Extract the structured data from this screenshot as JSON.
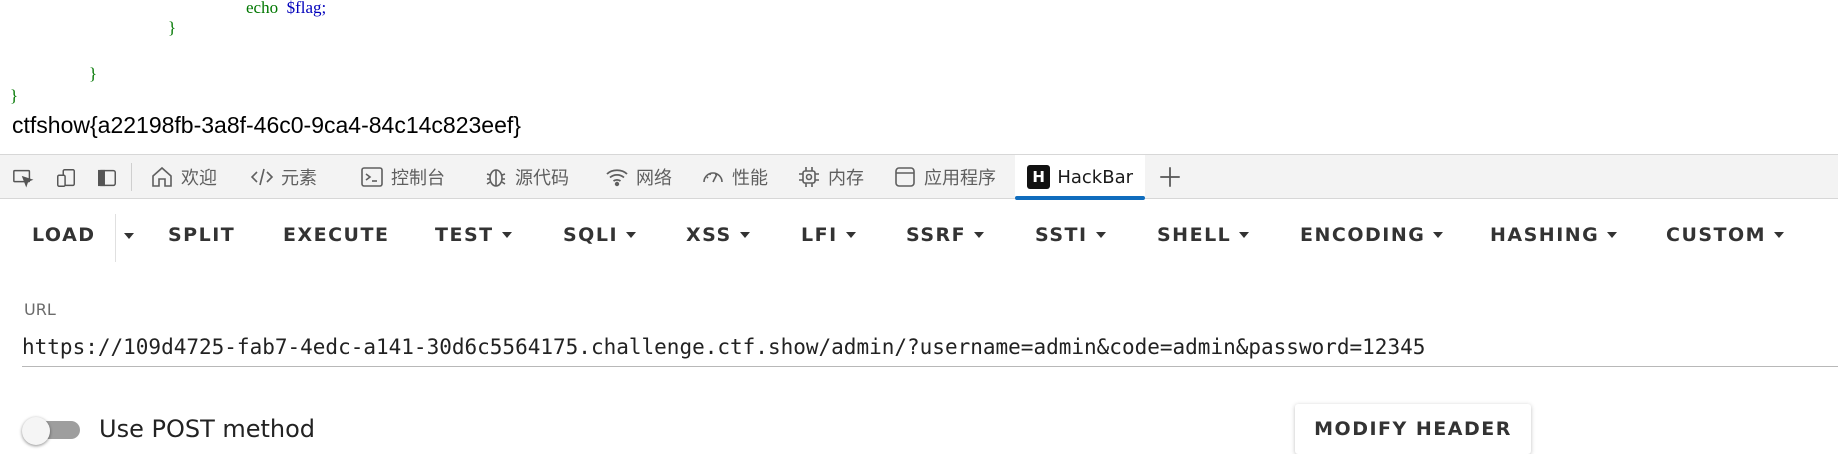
{
  "source": {
    "line1_keyword": "echo",
    "line1_var": "$flag;",
    "brace1": "}",
    "brace2": "}",
    "brace3": "}",
    "flag_output": "ctfshow{a22198fb-3a8f-46c0-9ca4-84c14c823eef}"
  },
  "devtools": {
    "tabs": [
      {
        "label": "欢迎",
        "icon": "home-icon"
      },
      {
        "label": "元素",
        "icon": "code-icon"
      },
      {
        "label": "控制台",
        "icon": "console-icon"
      },
      {
        "label": "源代码",
        "icon": "bug-icon"
      },
      {
        "label": "网络",
        "icon": "wifi-icon"
      },
      {
        "label": "性能",
        "icon": "gauge-icon"
      },
      {
        "label": "内存",
        "icon": "chip-icon"
      },
      {
        "label": "应用程序",
        "icon": "window-icon"
      },
      {
        "label": "HackBar",
        "icon": "hackbar-logo-icon",
        "logo_letter": "H",
        "active": true
      }
    ],
    "accent": "#0f6cbd"
  },
  "hackbar": {
    "buttons": {
      "load": "LOAD",
      "split": "SPLIT",
      "execute": "EXECUTE",
      "test": "TEST",
      "sqli": "SQLI",
      "xss": "XSS",
      "lfi": "LFI",
      "ssrf": "SSRF",
      "ssti": "SSTI",
      "shell": "SHELL",
      "encoding": "ENCODING",
      "hashing": "HASHING",
      "custom": "CUSTOM"
    },
    "url_label": "URL",
    "url_value": "https://109d4725-fab7-4edc-a141-30d6c5564175.challenge.ctf.show/admin/?username=admin&code=admin&password=12345",
    "post_toggle_label": "Use POST method",
    "post_enabled": false,
    "modify_header": "MODIFY HEADER"
  }
}
